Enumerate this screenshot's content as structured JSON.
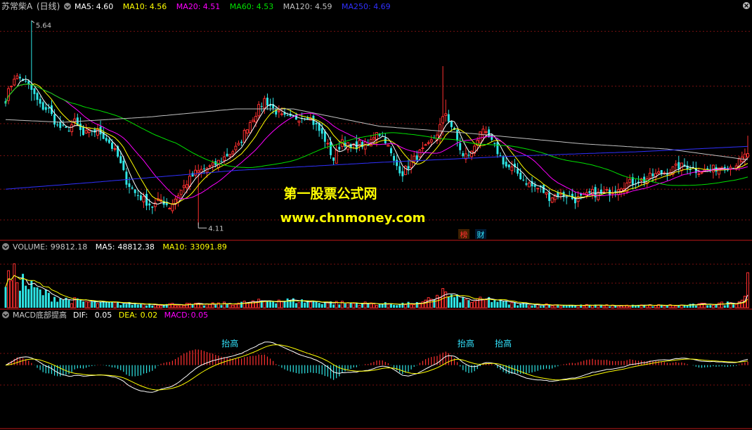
{
  "colors": {
    "background": "#000000",
    "grid": "#7a1010",
    "axis": "#c01818",
    "up": "#ff3030",
    "down": "#2ee6e6",
    "ma5": "#ffffff",
    "ma10": "#ffff00",
    "ma20": "#ff00ff",
    "ma60": "#00e000",
    "ma120": "#c0c0c0",
    "ma250": "#3030ff",
    "dif": "#ffffff",
    "dea": "#ffff00",
    "macd": "#ff00ff",
    "watermark": "#ffff00",
    "annotation": "#33e5ff",
    "label": "#c8c8c8"
  },
  "chart_data": [
    {
      "type": "candlestick",
      "title": "苏常柴A",
      "period": "(日线)",
      "moving_averages": [
        {
          "name": "MA5",
          "label": "MA5:",
          "value": "4.60",
          "color": "#ffffff"
        },
        {
          "name": "MA10",
          "label": "MA10:",
          "value": "4.56",
          "color": "#ffff00"
        },
        {
          "name": "MA20",
          "label": "MA20:",
          "value": "4.51",
          "color": "#ff00ff"
        },
        {
          "name": "MA60",
          "label": "MA60:",
          "value": "4.53",
          "color": "#00e000"
        },
        {
          "name": "MA120",
          "label": "MA120:",
          "value": "4.59",
          "color": "#c0c0c0"
        },
        {
          "name": "MA250",
          "label": "MA250:",
          "value": "4.69",
          "color": "#3030ff"
        }
      ],
      "annotations": {
        "high": {
          "label": "5.64",
          "value": 5.64
        },
        "low": {
          "label": "4.11",
          "value": 4.11
        }
      },
      "ylim": [
        4.05,
        5.7
      ],
      "price_anchors": [
        [
          0,
          5.05
        ],
        [
          3,
          5.22
        ],
        [
          6,
          5.2
        ],
        [
          9,
          5.12
        ],
        [
          12,
          5.0
        ],
        [
          15,
          4.97
        ],
        [
          18,
          4.85
        ],
        [
          21,
          4.82
        ],
        [
          24,
          4.88
        ],
        [
          27,
          4.78
        ],
        [
          30,
          4.82
        ],
        [
          33,
          4.8
        ],
        [
          36,
          4.73
        ],
        [
          39,
          4.62
        ],
        [
          42,
          4.44
        ],
        [
          45,
          4.35
        ],
        [
          48,
          4.3
        ],
        [
          51,
          4.25
        ],
        [
          54,
          4.3
        ],
        [
          57,
          4.25
        ],
        [
          60,
          4.34
        ],
        [
          63,
          4.43
        ],
        [
          66,
          4.5
        ],
        [
          69,
          4.53
        ],
        [
          72,
          4.55
        ],
        [
          75,
          4.6
        ],
        [
          78,
          4.65
        ],
        [
          81,
          4.7
        ],
        [
          84,
          4.85
        ],
        [
          87,
          4.95
        ],
        [
          90,
          5.05
        ],
        [
          93,
          4.98
        ],
        [
          96,
          4.92
        ],
        [
          99,
          4.9
        ],
        [
          102,
          4.92
        ],
        [
          105,
          4.93
        ],
        [
          108,
          4.85
        ],
        [
          111,
          4.75
        ],
        [
          114,
          4.6
        ],
        [
          117,
          4.75
        ],
        [
          120,
          4.68
        ],
        [
          123,
          4.72
        ],
        [
          126,
          4.7
        ],
        [
          129,
          4.82
        ],
        [
          132,
          4.75
        ],
        [
          135,
          4.58
        ],
        [
          138,
          4.5
        ],
        [
          141,
          4.58
        ],
        [
          144,
          4.65
        ],
        [
          147,
          4.7
        ],
        [
          150,
          4.8
        ],
        [
          153,
          4.95
        ],
        [
          156,
          4.8
        ],
        [
          159,
          4.62
        ],
        [
          162,
          4.65
        ],
        [
          165,
          4.82
        ],
        [
          168,
          4.76
        ],
        [
          171,
          4.66
        ],
        [
          174,
          4.55
        ],
        [
          177,
          4.52
        ],
        [
          180,
          4.45
        ],
        [
          183,
          4.4
        ],
        [
          186,
          4.38
        ],
        [
          189,
          4.32
        ],
        [
          192,
          4.34
        ],
        [
          195,
          4.33
        ],
        [
          198,
          4.3
        ],
        [
          201,
          4.32
        ],
        [
          204,
          4.35
        ],
        [
          207,
          4.34
        ],
        [
          210,
          4.36
        ],
        [
          213,
          4.4
        ],
        [
          216,
          4.42
        ],
        [
          219,
          4.44
        ],
        [
          222,
          4.45
        ],
        [
          225,
          4.48
        ],
        [
          228,
          4.5
        ],
        [
          231,
          4.52
        ],
        [
          234,
          4.55
        ],
        [
          237,
          4.55
        ],
        [
          240,
          4.52
        ],
        [
          243,
          4.52
        ],
        [
          246,
          4.53
        ],
        [
          249,
          4.55
        ],
        [
          252,
          4.55
        ],
        [
          255,
          4.58
        ],
        [
          258,
          4.65
        ]
      ],
      "ma120_anchors": [
        [
          0,
          4.9
        ],
        [
          20,
          4.88
        ],
        [
          50,
          4.92
        ],
        [
          80,
          4.98
        ],
        [
          100,
          4.98
        ],
        [
          130,
          4.85
        ],
        [
          160,
          4.8
        ],
        [
          200,
          4.72
        ],
        [
          230,
          4.68
        ],
        [
          258,
          4.6
        ]
      ],
      "ma250_anchors": [
        [
          0,
          4.38
        ],
        [
          30,
          4.43
        ],
        [
          80,
          4.52
        ],
        [
          130,
          4.58
        ],
        [
          180,
          4.63
        ],
        [
          220,
          4.66
        ],
        [
          258,
          4.7
        ]
      ]
    },
    {
      "type": "bar",
      "title": "VOLUME",
      "indicators": [
        {
          "label": "VOLUME:",
          "value": "99812.18",
          "color": "#c8c8c8"
        },
        {
          "label": "MA5:",
          "value": "48812.38",
          "color": "#ffffff"
        },
        {
          "label": "MA10:",
          "value": "33091.89",
          "color": "#ffff00"
        }
      ],
      "volume_anchors": [
        [
          0,
          78000
        ],
        [
          4,
          90000
        ],
        [
          8,
          60000
        ],
        [
          12,
          45000
        ],
        [
          16,
          32000
        ],
        [
          22,
          22000
        ],
        [
          30,
          15000
        ],
        [
          40,
          12000
        ],
        [
          55,
          10000
        ],
        [
          70,
          9000
        ],
        [
          85,
          15000
        ],
        [
          95,
          22000
        ],
        [
          105,
          18000
        ],
        [
          115,
          14000
        ],
        [
          130,
          11000
        ],
        [
          145,
          12000
        ],
        [
          152,
          45000
        ],
        [
          155,
          30000
        ],
        [
          162,
          18000
        ],
        [
          168,
          24000
        ],
        [
          175,
          12000
        ],
        [
          190,
          8000
        ],
        [
          210,
          6000
        ],
        [
          235,
          7000
        ],
        [
          250,
          12000
        ],
        [
          256,
          20000
        ],
        [
          258,
          99812
        ]
      ],
      "ylim": [
        0,
        160000
      ]
    },
    {
      "type": "macd",
      "title": "MACD底部提高",
      "indicators": [
        {
          "label": "DIF:",
          "value": "0.05",
          "color": "#ffffff"
        },
        {
          "label": "DEA:",
          "value": "0.02",
          "color": "#ffff00"
        },
        {
          "label": "MACD:",
          "value": "0.05",
          "color": "#ff00ff"
        }
      ],
      "annotations": [
        {
          "label": "抬高",
          "index": 78
        },
        {
          "label": "抬高",
          "index": 160
        },
        {
          "label": "抬高",
          "index": 173
        }
      ],
      "ylim": [
        -0.35,
        0.25
      ]
    }
  ],
  "watermark": {
    "line1": "第一股票公式网",
    "line2": "www.chnmoney.com"
  },
  "badges": [
    {
      "label": "榜",
      "color": "#ff3030"
    },
    {
      "label": "财",
      "color": "#33e5ff"
    }
  ]
}
